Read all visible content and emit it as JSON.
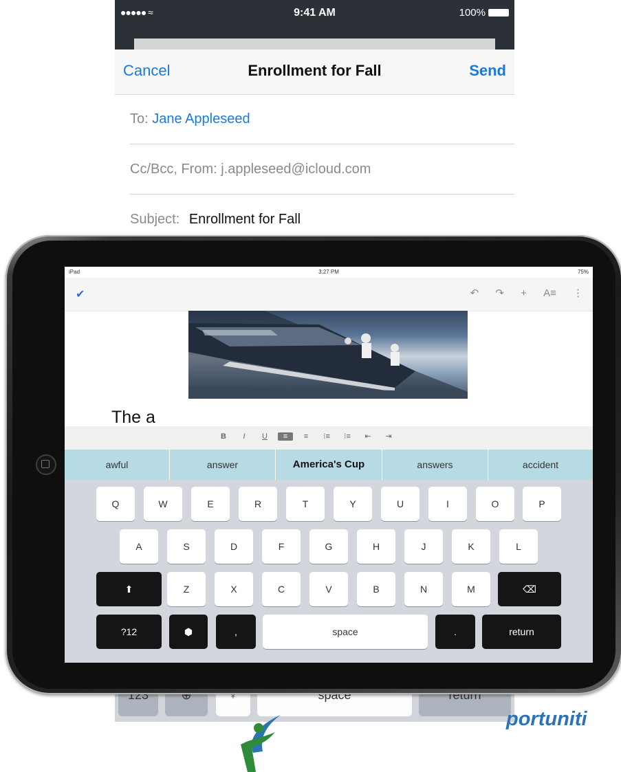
{
  "phone": {
    "status": {
      "signal": "●●●●● ≈",
      "time": "9:41 AM",
      "battery": "100%"
    },
    "nav": {
      "cancel": "Cancel",
      "title": "Enrollment for Fall",
      "send": "Send"
    },
    "to_label": "To:",
    "to_value": "Jane Appleseed",
    "cc_label": "Cc/Bcc, From:",
    "cc_value": "j.appleseed@icloud.com",
    "subject_label": "Subject:",
    "subject_value": "Enrollment for Fall",
    "keys": {
      "numbers": "123",
      "space": "space",
      "return": "return"
    }
  },
  "ipad": {
    "status": {
      "left": "iPad",
      "time": "3:27 PM",
      "battery": "75%"
    },
    "toolbar": {
      "done_icon": "checkmark-icon",
      "undo": "↶",
      "redo": "↷",
      "add": "+",
      "text_format": "A≡",
      "more": "⋮"
    },
    "document_text": "The a",
    "format_buttons": [
      "B",
      "I",
      "U",
      "≡",
      "≡",
      "⁝≡",
      "⁝≡",
      "⇤",
      "⇥"
    ],
    "suggestions": [
      "awful",
      "answer",
      "America's Cup",
      "answers",
      "accident"
    ],
    "keyboard": {
      "row1": [
        "Q",
        "W",
        "E",
        "R",
        "T",
        "Y",
        "U",
        "I",
        "O",
        "P"
      ],
      "row2": [
        "A",
        "S",
        "D",
        "F",
        "G",
        "H",
        "J",
        "K",
        "L"
      ],
      "row3": [
        "Z",
        "X",
        "C",
        "V",
        "B",
        "N",
        "M"
      ],
      "shift": "⬆",
      "backspace": "⌫",
      "numbers": "?12",
      "hide": "⬢",
      "comma": ",",
      "space": "space",
      "period": ".",
      "return": "return"
    }
  },
  "footer": {
    "brand_text": "portuniti"
  },
  "colors": {
    "ios_blue": "#1a7ad9",
    "suggestion_bar": "#b7dbe5",
    "brand_blue": "#2b73b5",
    "brand_green": "#2e8b3a"
  }
}
